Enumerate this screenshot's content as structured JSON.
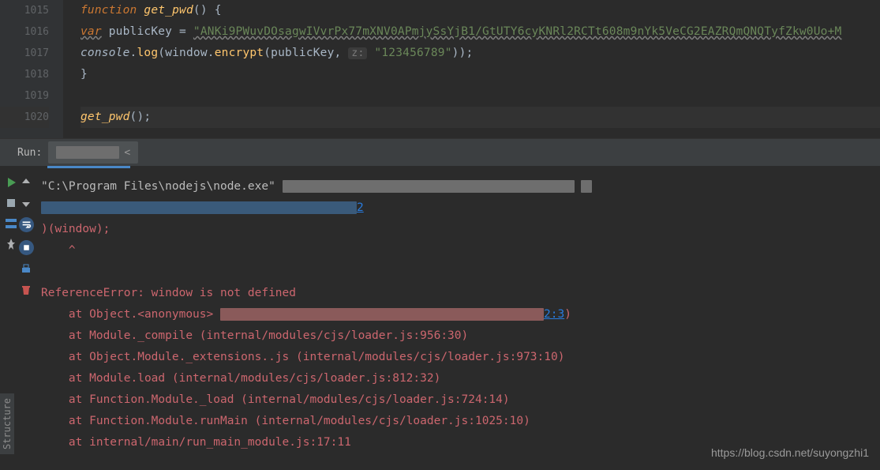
{
  "editor": {
    "lines": [
      "1015",
      "1016",
      "1017",
      "1018",
      "1019",
      "1020"
    ],
    "code": {
      "l1": {
        "kw": "function",
        "fn": "get_pwd",
        "tail": "() {"
      },
      "l2": {
        "kw": "var",
        "varname": "publicKey",
        "op": "=",
        "str": "\"ANKi9PWuvDOsagwIVvrPx77mXNV0APmjySsYjB1/GtUTY6cyKNRl2RCTt608m9nYk5VeCG2EAZRQmQNQTyfZkw0Uo+M"
      },
      "l3": {
        "obj": "console",
        "dot1": ".",
        "m1": "log",
        "p1": "(",
        "obj2": "window",
        "dot2": ".",
        "m2": "encrypt",
        "p2": "(",
        "arg1": "publicKey",
        "comma": ",",
        "hint": "z:",
        "str": "\"123456789\"",
        "tail": "));"
      },
      "l4": "}",
      "l6": {
        "call": "get_pwd",
        "tail": "();"
      }
    }
  },
  "run": {
    "label": "Run:",
    "tab_close": "<"
  },
  "console": {
    "cmd_path": "\"C:\\Program Files\\nodejs\\node.exe\"",
    "line2_tail": "2",
    "line3": ")(window);",
    "line4": "    ^",
    "err_main": "ReferenceError: window is not defined",
    "trace": [
      {
        "prefix": "    at Object.<anonymous> ",
        "link": "2:3",
        "tail": ")"
      },
      {
        "text": "    at Module._compile (internal/modules/cjs/loader.js:956:30)"
      },
      {
        "text": "    at Object.Module._extensions..js (internal/modules/cjs/loader.js:973:10)"
      },
      {
        "text": "    at Module.load (internal/modules/cjs/loader.js:812:32)"
      },
      {
        "text": "    at Function.Module._load (internal/modules/cjs/loader.js:724:14)"
      },
      {
        "text": "    at Function.Module.runMain (internal/modules/cjs/loader.js:1025:10)"
      },
      {
        "text": "    at internal/main/run_main_module.js:17:11"
      }
    ]
  },
  "sidebar": {
    "structure": "Structure"
  },
  "watermark": {
    "url": "https://blog.csdn.net/suyongzhi1"
  }
}
